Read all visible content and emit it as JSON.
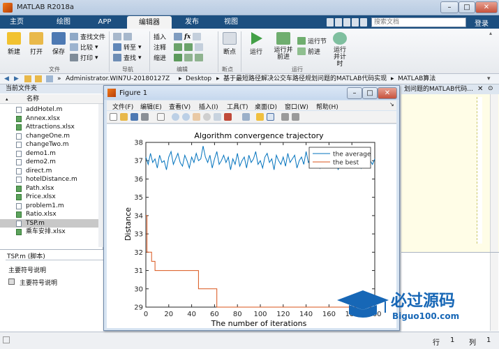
{
  "app": {
    "title": "MATLAB R2018a",
    "search_placeholder": "搜索文档",
    "login": "登录"
  },
  "tabs": [
    "主页",
    "绘图",
    "APP",
    "编辑器",
    "发布",
    "视图"
  ],
  "ribbon": {
    "file": {
      "new": "新建",
      "open": "打开",
      "save": "保存",
      "find_files": "查找文件",
      "compare": "比较",
      "print": "打印",
      "group": "文件"
    },
    "nav": {
      "goto": "转至",
      "find": "查找",
      "group": "导航"
    },
    "edit": {
      "insert": "插入",
      "comment": "注释",
      "indent": "缩进",
      "fx": "fx",
      "group": "编辑"
    },
    "breakpoint": {
      "label": "断点",
      "group": "断点"
    },
    "run": {
      "run": "运行",
      "run_advance": "运行并前进",
      "run_section": "运行节",
      "advance": "前进",
      "run_time": "运行并计时",
      "group": "运行"
    }
  },
  "address": {
    "path": [
      "Administrator.WIN7U-20180127Z",
      "Desktop",
      "基于最短路径解决公交车路径规划问题的MATLAB代码实现",
      "MATLAB算法"
    ]
  },
  "current_folder": {
    "title": "当前文件夹",
    "col_name": "名称",
    "files": [
      {
        "name": "addHotel.m",
        "type": "m"
      },
      {
        "name": "Annex.xlsx",
        "type": "xls"
      },
      {
        "name": "Attractions.xlsx",
        "type": "xls"
      },
      {
        "name": "changeOne.m",
        "type": "m"
      },
      {
        "name": "changeTwo.m",
        "type": "m"
      },
      {
        "name": "demo1.m",
        "type": "m"
      },
      {
        "name": "demo2.m",
        "type": "m"
      },
      {
        "name": "direct.m",
        "type": "m"
      },
      {
        "name": "hotelDistance.m",
        "type": "m"
      },
      {
        "name": "Path.xlsx",
        "type": "xls"
      },
      {
        "name": "Price.xlsx",
        "type": "xls"
      },
      {
        "name": "problem1.m",
        "type": "m"
      },
      {
        "name": "Ratio.xlsx",
        "type": "xls"
      },
      {
        "name": "TSP.m",
        "type": "m",
        "selected": true
      },
      {
        "name": "乘车安排.xlsx",
        "type": "xls"
      }
    ]
  },
  "details": {
    "title": "TSP.m (脚本)",
    "heading": "主要符号说明",
    "item": "主要符号说明"
  },
  "editor_tab_fragment": "划问题的MATLAB代码...",
  "statusbar": {
    "row_label": "行",
    "row": "1",
    "col_label": "列",
    "col": "1"
  },
  "figure": {
    "title": "Figure 1",
    "menu": [
      "文件(F)",
      "编辑(E)",
      "查看(V)",
      "插入(I)",
      "工具(T)",
      "桌面(D)",
      "窗口(W)",
      "帮助(H)"
    ]
  },
  "watermark": {
    "text": "必过源码",
    "url": "Biguo100.com"
  },
  "chart_data": {
    "type": "line",
    "title": "Algorithm convergence trajectory",
    "xlabel": "The number of iterations",
    "ylabel": "Distance",
    "xlim": [
      0,
      200
    ],
    "ylim": [
      29,
      38
    ],
    "xticks": [
      0,
      20,
      40,
      60,
      80,
      100,
      120,
      140,
      160,
      180,
      200
    ],
    "yticks": [
      29,
      30,
      31,
      32,
      33,
      34,
      35,
      36,
      37,
      38
    ],
    "legend_position": "top-right",
    "series": [
      {
        "name": "the average",
        "color": "#0072bd",
        "x": [
          0,
          2,
          4,
          6,
          8,
          10,
          12,
          14,
          16,
          18,
          20,
          22,
          24,
          26,
          28,
          30,
          32,
          34,
          36,
          38,
          40,
          42,
          44,
          46,
          48,
          50,
          52,
          54,
          56,
          58,
          60,
          62,
          64,
          66,
          68,
          70,
          72,
          74,
          76,
          78,
          80,
          82,
          84,
          86,
          88,
          90,
          92,
          94,
          96,
          98,
          100,
          102,
          104,
          106,
          108,
          110,
          112,
          114,
          116,
          118,
          120,
          122,
          124,
          126,
          128,
          130,
          132,
          134,
          136,
          138,
          140,
          142,
          144,
          146,
          148,
          150,
          152,
          154,
          156,
          158,
          160,
          162,
          164,
          166,
          168,
          170,
          172,
          174,
          176,
          178,
          180,
          182,
          184,
          186,
          188,
          190,
          192,
          194,
          196,
          198,
          200
        ],
        "y": [
          37.2,
          36.8,
          37.4,
          36.9,
          37.1,
          36.6,
          37.3,
          36.9,
          37.0,
          36.5,
          37.2,
          37.5,
          36.8,
          37.1,
          37.4,
          36.9,
          36.7,
          37.3,
          37.0,
          36.6,
          37.2,
          36.9,
          37.4,
          37.0,
          37.1,
          37.8,
          37.2,
          36.9,
          37.3,
          36.6,
          37.1,
          37.5,
          36.8,
          37.0,
          37.3,
          36.9,
          37.2,
          36.5,
          37.1,
          36.8,
          37.4,
          36.7,
          37.0,
          37.2,
          36.6,
          37.3,
          36.9,
          37.1,
          37.5,
          36.8,
          37.0,
          36.6,
          37.2,
          37.4,
          36.9,
          37.1,
          36.5,
          37.3,
          37.0,
          36.8,
          37.2,
          36.7,
          37.4,
          36.9,
          37.1,
          37.3,
          36.6,
          37.0,
          37.2,
          36.8,
          37.5,
          36.9,
          37.1,
          36.7,
          37.3,
          37.0,
          36.6,
          37.2,
          36.9,
          37.4,
          37.0,
          36.8,
          37.1,
          37.3,
          36.5,
          37.0,
          37.2,
          36.8,
          37.4,
          36.9,
          37.1,
          36.7,
          37.3,
          37.0,
          36.6,
          37.2,
          36.9,
          37.4,
          37.0,
          36.8,
          37.1
        ]
      },
      {
        "name": "the best",
        "color": "#d95319",
        "x": [
          0,
          1,
          1,
          5,
          5,
          8,
          8,
          46,
          46,
          58,
          58,
          62,
          62,
          200
        ],
        "y": [
          34,
          34,
          32,
          32,
          31.5,
          31.5,
          31,
          31,
          30,
          30,
          30,
          30,
          29,
          29
        ]
      }
    ]
  }
}
